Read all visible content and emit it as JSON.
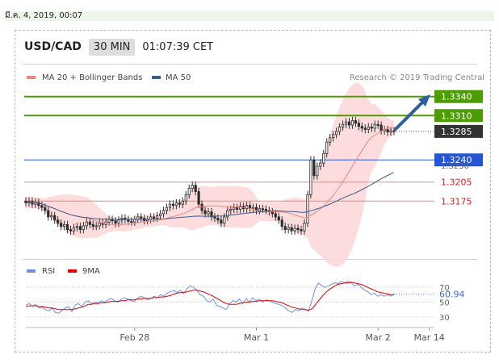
{
  "header": {
    "timestamp": "มี.ค. 4, 2019, 00:07",
    "pair": "USD/CAD",
    "timeframe": "30 MIN",
    "clock": "01:07:39 CET"
  },
  "legend": {
    "ma20": "MA 20 + Bollinger Bands",
    "ma50": "MA 50",
    "credit": "Research © 2019 Trading Central",
    "rsi": "RSI",
    "ma9": "9MA"
  },
  "colors": {
    "resistance": "#4c9e00",
    "pivot": "#2455d4",
    "support": "#f08585",
    "price": "#333333",
    "arrow": "#2e5fa0",
    "ma20": "#f08585",
    "ma50": "#3a5d8f",
    "band": "#fbd6d6",
    "rsi": "#6c93e0",
    "rsi_ma": "#e00000"
  },
  "chart_data": [
    {
      "type": "line",
      "ylim": [
        1.309,
        1.336
      ],
      "xlim": [
        0,
        130
      ],
      "x_ticks": [
        {
          "x": 34,
          "label": "Feb 28"
        },
        {
          "x": 72,
          "label": "Mar 1"
        },
        {
          "x": 110,
          "label": "Mar 2"
        },
        {
          "x": 126,
          "label": "Mar 14"
        }
      ],
      "levels": [
        {
          "value": 1.334,
          "label": "1.3340",
          "role": "resistance"
        },
        {
          "value": 1.331,
          "label": "1.3310",
          "role": "resistance"
        },
        {
          "value": 1.3285,
          "label": "1.3285",
          "role": "price"
        },
        {
          "value": 1.324,
          "label": "1.3240",
          "role": "pivot"
        },
        {
          "value": 1.3205,
          "label": "1.3205",
          "role": "support"
        },
        {
          "value": 1.3175,
          "label": "1.3175",
          "role": "support"
        }
      ],
      "secondary_label": {
        "value": 1.323,
        "label": "1.3230"
      },
      "series": [
        {
          "values": [
            1.3172,
            1.3175,
            1.317,
            1.3173,
            1.3168,
            1.3165,
            1.316,
            1.315,
            1.3152,
            1.3145,
            1.314,
            1.3135,
            1.3138,
            1.313,
            1.3128,
            1.3133,
            1.3135,
            1.313,
            1.3136,
            1.3142,
            1.3138,
            1.3135,
            1.3136,
            1.314,
            1.3138,
            1.3142,
            1.3146,
            1.3144,
            1.314,
            1.3145,
            1.3148,
            1.3146,
            1.3143,
            1.3142,
            1.3146,
            1.315,
            1.3148,
            1.3144,
            1.3146,
            1.315,
            1.3148,
            1.3152,
            1.3155,
            1.316,
            1.3165,
            1.317,
            1.3168,
            1.3172,
            1.317,
            1.3175,
            1.3185,
            1.3195,
            1.32,
            1.319,
            1.317,
            1.316,
            1.3155,
            1.3158,
            1.315,
            1.3148,
            1.3145,
            1.314,
            1.315,
            1.316,
            1.3162,
            1.3165,
            1.3162,
            1.3167,
            1.3163,
            1.3168,
            1.3163,
            1.3165,
            1.316,
            1.3163,
            1.3162,
            1.316,
            1.3158,
            1.3155,
            1.315,
            1.3145,
            1.3135,
            1.313,
            1.3133,
            1.3128,
            1.3132,
            1.313,
            1.3128,
            1.314,
            1.3185,
            1.324,
            1.3215,
            1.323,
            1.3235,
            1.325,
            1.3268,
            1.3275,
            1.328,
            1.3285,
            1.3292,
            1.3296,
            1.33,
            1.3295,
            1.3302,
            1.3298,
            1.3293,
            1.329,
            1.3288,
            1.3292,
            1.329,
            1.3296,
            1.3295,
            1.3286,
            1.3288,
            1.3284,
            1.3286,
            1.3285
          ]
        }
      ]
    },
    {
      "type": "line",
      "ylim": [
        20,
        80
      ],
      "y_ticks": [
        30,
        50,
        70
      ],
      "last_value": 60.94,
      "series": [
        {
          "name": "RSI",
          "values": [
            46,
            48,
            44,
            47,
            42,
            43,
            40,
            38,
            42,
            36,
            35,
            39,
            42,
            44,
            37,
            46,
            48,
            44,
            50,
            52,
            48,
            50,
            49,
            52,
            50,
            53,
            55,
            52,
            50,
            54,
            56,
            54,
            52,
            51,
            55,
            58,
            56,
            53,
            55,
            58,
            56,
            60,
            58,
            62,
            64,
            66,
            63,
            66,
            62,
            68,
            72,
            70,
            66,
            60,
            58,
            52,
            50,
            54,
            46,
            44,
            42,
            40,
            48,
            52,
            50,
            54,
            48,
            55,
            50,
            56,
            52,
            54,
            50,
            53,
            52,
            50,
            48,
            47,
            45,
            42,
            38,
            36,
            40,
            38,
            42,
            40,
            38,
            52,
            68,
            76,
            72,
            70,
            72,
            74,
            76,
            75,
            78,
            76,
            78,
            76,
            72,
            74,
            70,
            66,
            64,
            60,
            62,
            58,
            60,
            58,
            60,
            58,
            61
          ]
        },
        {
          "name": "9MA",
          "values": [
            44,
            45,
            45,
            45,
            44,
            44,
            43,
            42,
            42,
            41,
            40,
            40,
            40,
            40,
            40,
            41,
            42,
            43,
            45,
            47,
            47,
            48,
            48,
            49,
            49,
            50,
            51,
            51,
            51,
            52,
            52,
            53,
            53,
            53,
            54,
            54,
            55,
            55,
            55,
            56,
            56,
            57,
            57,
            58,
            59,
            61,
            62,
            63,
            63,
            64,
            65,
            66,
            66,
            65,
            64,
            62,
            60,
            58,
            55,
            53,
            50,
            48,
            47,
            47,
            47,
            48,
            49,
            50,
            50,
            51,
            51,
            52,
            52,
            52,
            52,
            52,
            51,
            50,
            49,
            47,
            45,
            43,
            42,
            41,
            40,
            40,
            39,
            41,
            46,
            52,
            57,
            62,
            66,
            69,
            72,
            74,
            75,
            76,
            76,
            77,
            76,
            75,
            74,
            72,
            70,
            68,
            66,
            64,
            63,
            62,
            61,
            60,
            60
          ]
        }
      ]
    }
  ]
}
